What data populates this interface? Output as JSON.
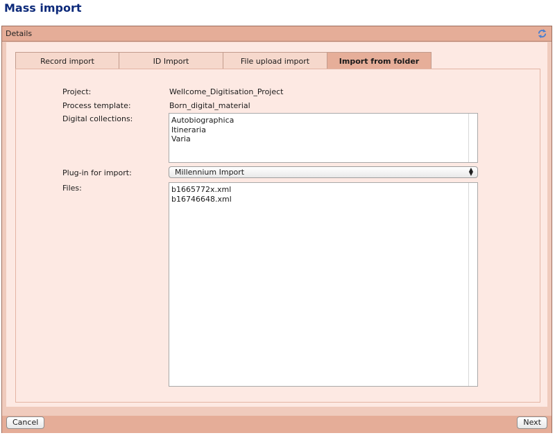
{
  "page": {
    "title": "Mass import"
  },
  "panel": {
    "header": "Details"
  },
  "tabs": [
    {
      "label": "Record import",
      "active": false
    },
    {
      "label": "ID Import",
      "active": false
    },
    {
      "label": "File upload import",
      "active": false
    },
    {
      "label": "Import from folder",
      "active": true
    }
  ],
  "form": {
    "project_label": "Project:",
    "project_value": "Wellcome_Digitisation_Project",
    "template_label": "Process template:",
    "template_value": "Born_digital_material",
    "collections_label": "Digital collections:",
    "collections": [
      "Autobiographica",
      "Itineraria",
      "Varia"
    ],
    "plugin_label": "Plug-in for import:",
    "plugin_value": "Millennium Import",
    "files_label": "Files:",
    "files": [
      "b1665772x.xml",
      "b16746648.xml"
    ]
  },
  "footer": {
    "cancel_label": "Cancel",
    "next_label": "Next"
  },
  "colors": {
    "title": "#0d2a7a",
    "panel_header": "#e5ad98",
    "panel_body": "#f0cbbd",
    "content_bg": "#fde9e3",
    "active_tab": "#e6ae99"
  },
  "icons": {
    "panel_header_action": "refresh-icon",
    "select_arrow": "updown-arrows-icon"
  }
}
